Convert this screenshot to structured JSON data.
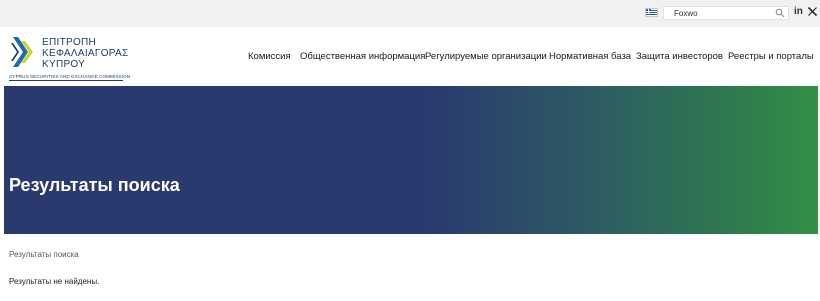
{
  "topbar": {
    "language_flag": "greek-flag-icon",
    "search": {
      "value": "Foxwo",
      "icon": "search-icon"
    },
    "social": {
      "linkedin": "in",
      "x_icon": "x-icon"
    }
  },
  "logo": {
    "line1": "ΕΠΙΤΡΟΠΗ",
    "line2": "ΚΕΦΑΛΑΙΑΓΟΡΑΣ",
    "line3": "ΚΥΠΡΟΥ",
    "subtitle": "CYPRUS SECURITIES AND EXCHANGE COMMISSION"
  },
  "nav": {
    "items": [
      {
        "label": "Комиссия"
      },
      {
        "label": "Общественная информация"
      },
      {
        "label": "Регулируемые организации"
      },
      {
        "label": "Нормативная база"
      },
      {
        "label": "Защита инвесторов"
      },
      {
        "label": "Реестры и порталы"
      }
    ]
  },
  "hero": {
    "title": "Результаты поиска"
  },
  "breadcrumb": {
    "current": "Результаты поиска"
  },
  "main": {
    "message": "Результаты не найдены."
  },
  "colors": {
    "hero_start": "#2a3a6f",
    "hero_end": "#339048",
    "topbar_bg": "#f2f1f1",
    "brand_navy": "#1f3c6d"
  }
}
